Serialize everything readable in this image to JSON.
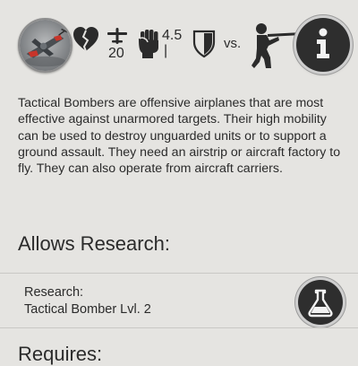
{
  "unit": {
    "portrait_icon": "tactical-bomber-portrait",
    "health_icon": "broken-heart-icon",
    "movement_icon": "airplane-icon",
    "movement_value": "20",
    "strength_icon": "fist-icon",
    "strength_value": "4.5",
    "strength_sub": "|",
    "defense_icon": "shield-icon",
    "versus_label": "vs.",
    "versus_icon": "rifleman-icon",
    "info_icon": "info-icon"
  },
  "description": "Tactical Bombers are offensive airplanes that are most effective against unarmored targets. Their high mobility can be used to destroy unguarded units or to support a ground assault. They need an airstrip or aircraft factory to fly. They can also operate from aircraft carriers.",
  "allows_research": {
    "title": "Allows Research:",
    "item_label": "Research:",
    "item_name": "Tactical Bomber Lvl. 2",
    "button_icon": "flask-icon"
  },
  "requires": {
    "title": "Requires:"
  },
  "colors": {
    "background": "#e5e4e1",
    "text": "#2b2b2b",
    "button_fill": "#2e2e2e"
  }
}
